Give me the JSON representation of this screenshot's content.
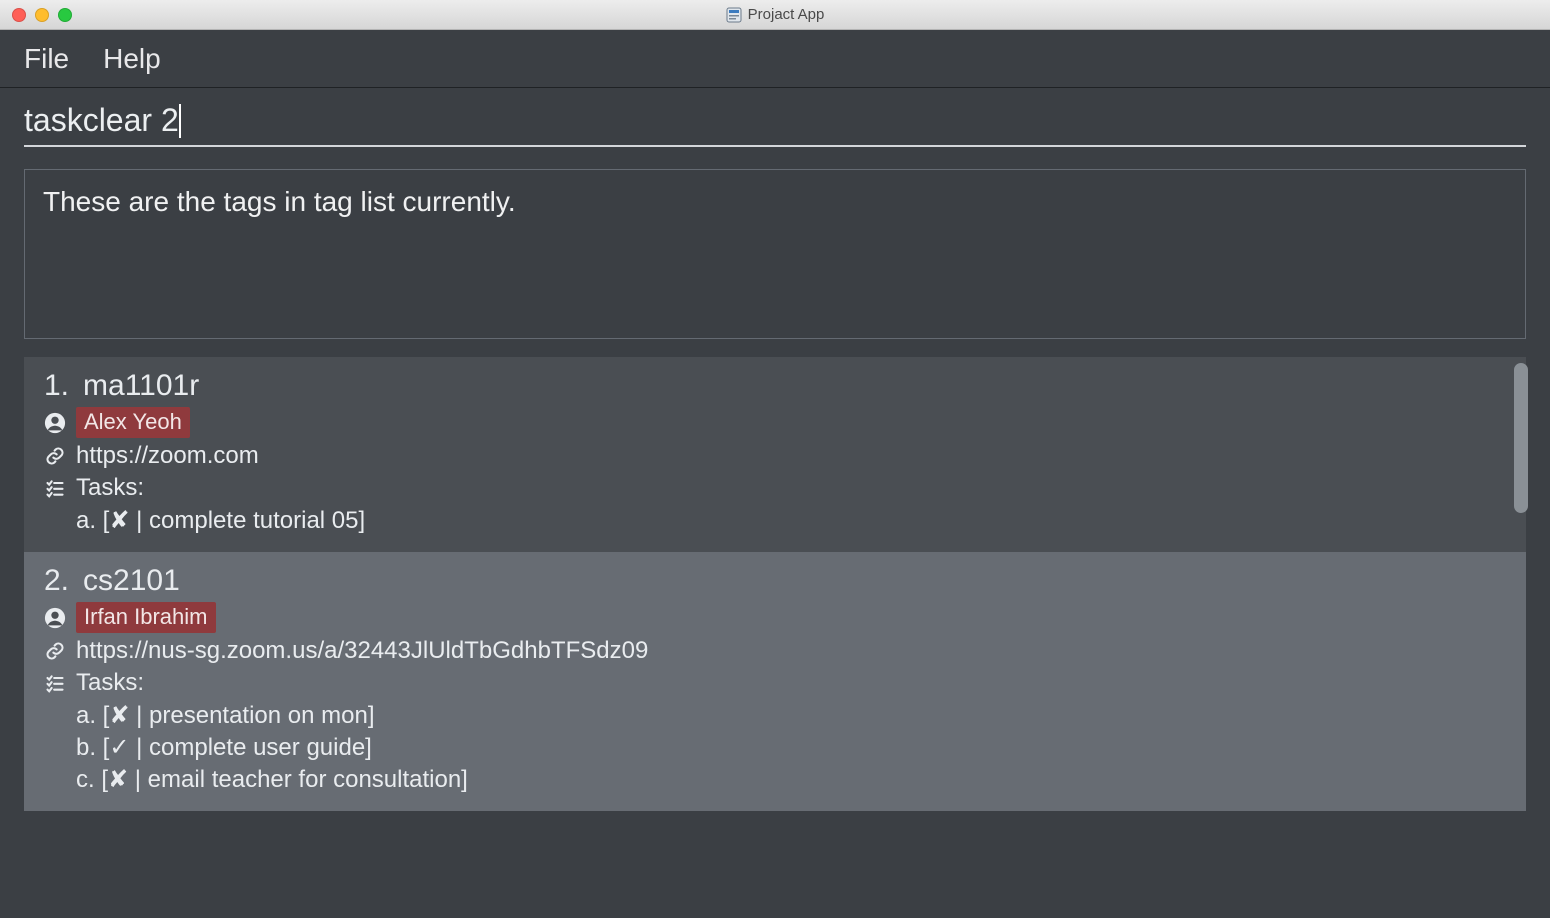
{
  "window": {
    "title": "Projact App"
  },
  "menubar": {
    "file": "File",
    "help": "Help"
  },
  "command": {
    "value": "taskclear 2"
  },
  "status": {
    "message": "These are the tags in tag list currently."
  },
  "labels": {
    "tasks_heading": "Tasks:"
  },
  "items": [
    {
      "index": "1.",
      "name": "ma1101r",
      "person": "Alex Yeoh",
      "link": "https://zoom.com",
      "tasks": [
        "a. [✘ | complete tutorial 05]"
      ],
      "shade": "dark"
    },
    {
      "index": "2.",
      "name": "cs2101",
      "person": "Irfan Ibrahim",
      "link": "https://nus-sg.zoom.us/a/32443JlUldTbGdhbTFSdz09",
      "tasks": [
        "a. [✘ | presentation on mon]",
        "b. [✓ | complete user guide]",
        "c. [✘ | email teacher for consultation]"
      ],
      "shade": "light"
    }
  ]
}
